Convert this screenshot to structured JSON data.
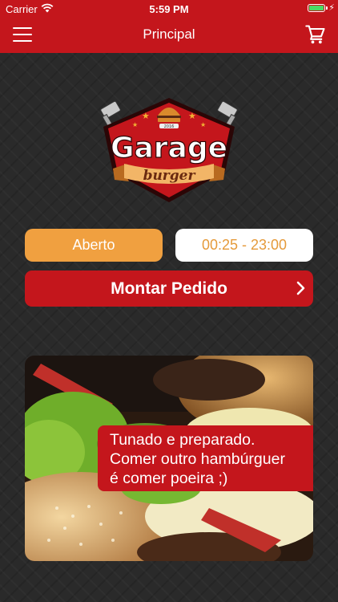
{
  "status_bar": {
    "carrier": "Carrier",
    "time": "5:59 PM",
    "battery_level": 1.0,
    "battery_color": "#4cd964"
  },
  "navbar": {
    "title": "Principal",
    "menu_icon": "hamburger-menu-icon",
    "cart_icon": "shopping-cart-icon",
    "background": "#c4161c"
  },
  "logo": {
    "name": "Garage",
    "tagline": "burger",
    "year": "2016"
  },
  "store": {
    "status_label": "Aberto",
    "status_color": "#f0a040",
    "hours": "00:25 - 23:00"
  },
  "order_button": {
    "label": "Montar Pedido",
    "icon": "chevron-right-icon"
  },
  "promo": {
    "lines": [
      "Tunado e preparado.",
      "Comer outro hambúrguer",
      "é comer poeira ;)"
    ]
  }
}
